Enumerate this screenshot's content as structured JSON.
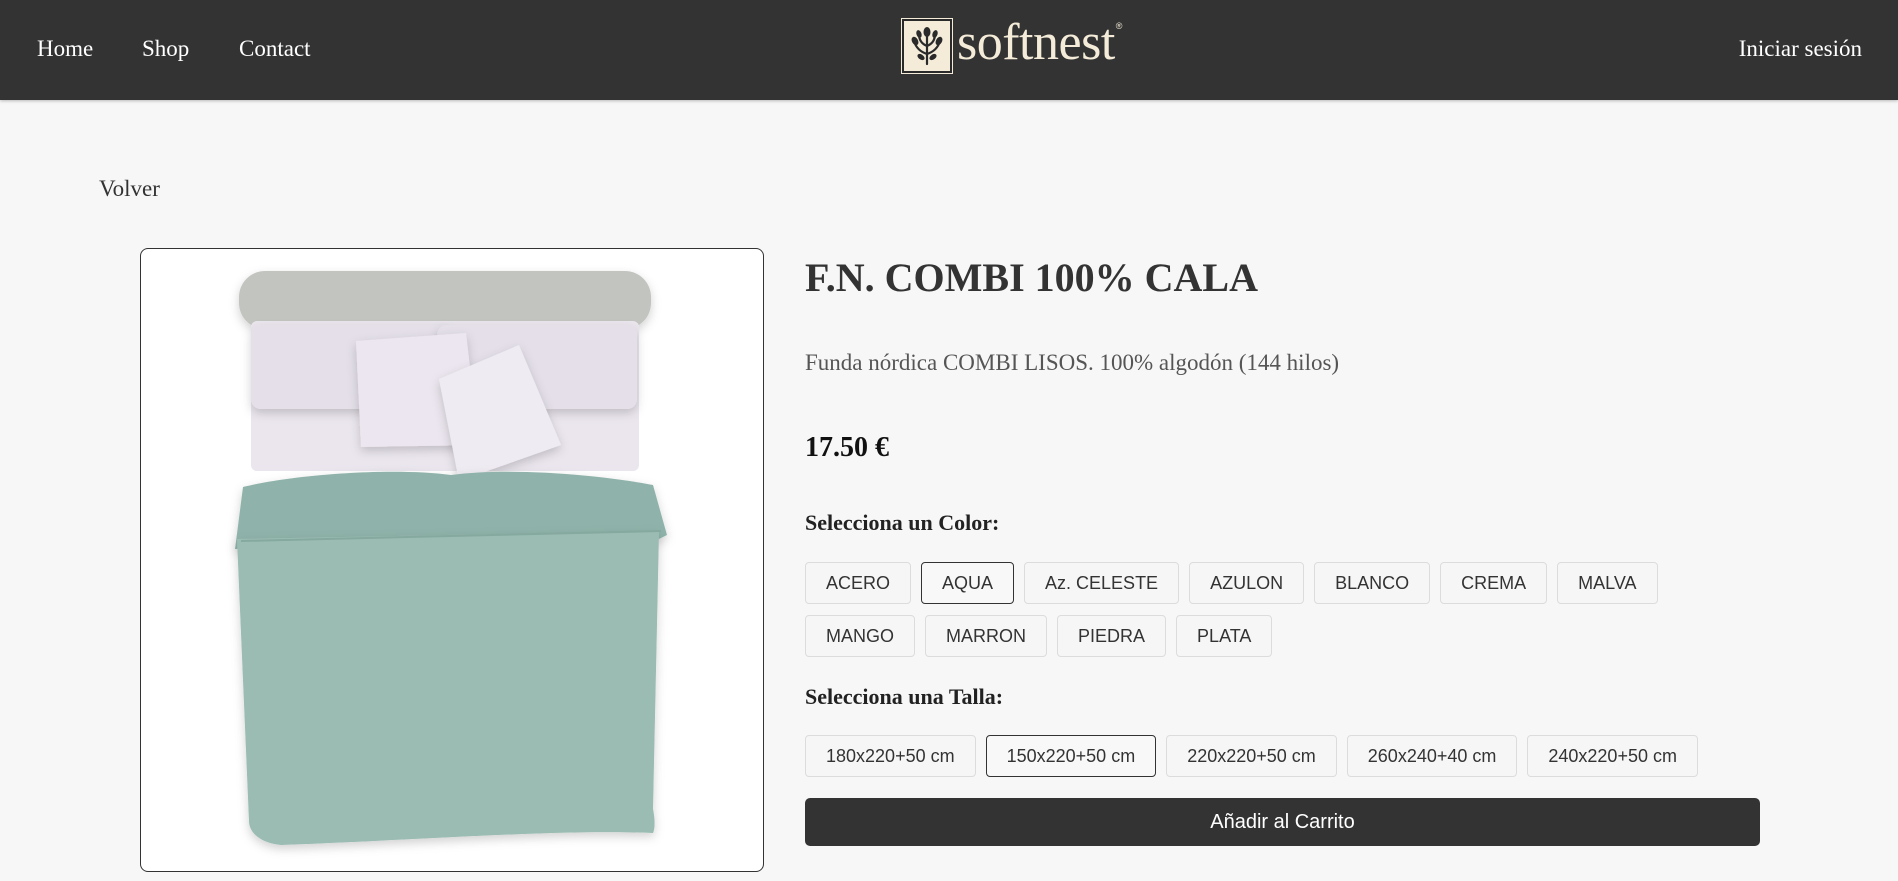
{
  "nav": {
    "links": [
      "Home",
      "Shop",
      "Contact"
    ],
    "brand_name": "softnest",
    "brand_mark": "®",
    "login_label": "Iniciar sesión"
  },
  "back_label": "Volver",
  "product": {
    "title": "F.N. COMBI 100% CALA",
    "description": "Funda nórdica COMBI LISOS. 100% algodón (144 hilos)",
    "price": "17.50 €",
    "image_icon": "duvet-cover-photo"
  },
  "color_section": {
    "label": "Selecciona un Color:",
    "options": [
      "ACERO",
      "AQUA",
      "Az. CELESTE",
      "AZULON",
      "BLANCO",
      "CREMA",
      "MALVA",
      "MANGO",
      "MARRON",
      "PIEDRA",
      "PLATA"
    ],
    "selected": "AQUA"
  },
  "size_section": {
    "label": "Selecciona una Talla:",
    "options": [
      "180x220+50 cm",
      "150x220+50 cm",
      "220x220+50 cm",
      "260x240+40 cm",
      "240x220+50 cm"
    ],
    "selected": "150x220+50 cm"
  },
  "cart_label": "Añadir al Carrito",
  "colors": {
    "header_bg": "#333333",
    "page_bg": "#f7f7f7",
    "brand_cream": "#f4ecd9",
    "duvet": "#9abcb3",
    "pillow": "#e6e0ea",
    "headboard": "#c2c4bf"
  }
}
